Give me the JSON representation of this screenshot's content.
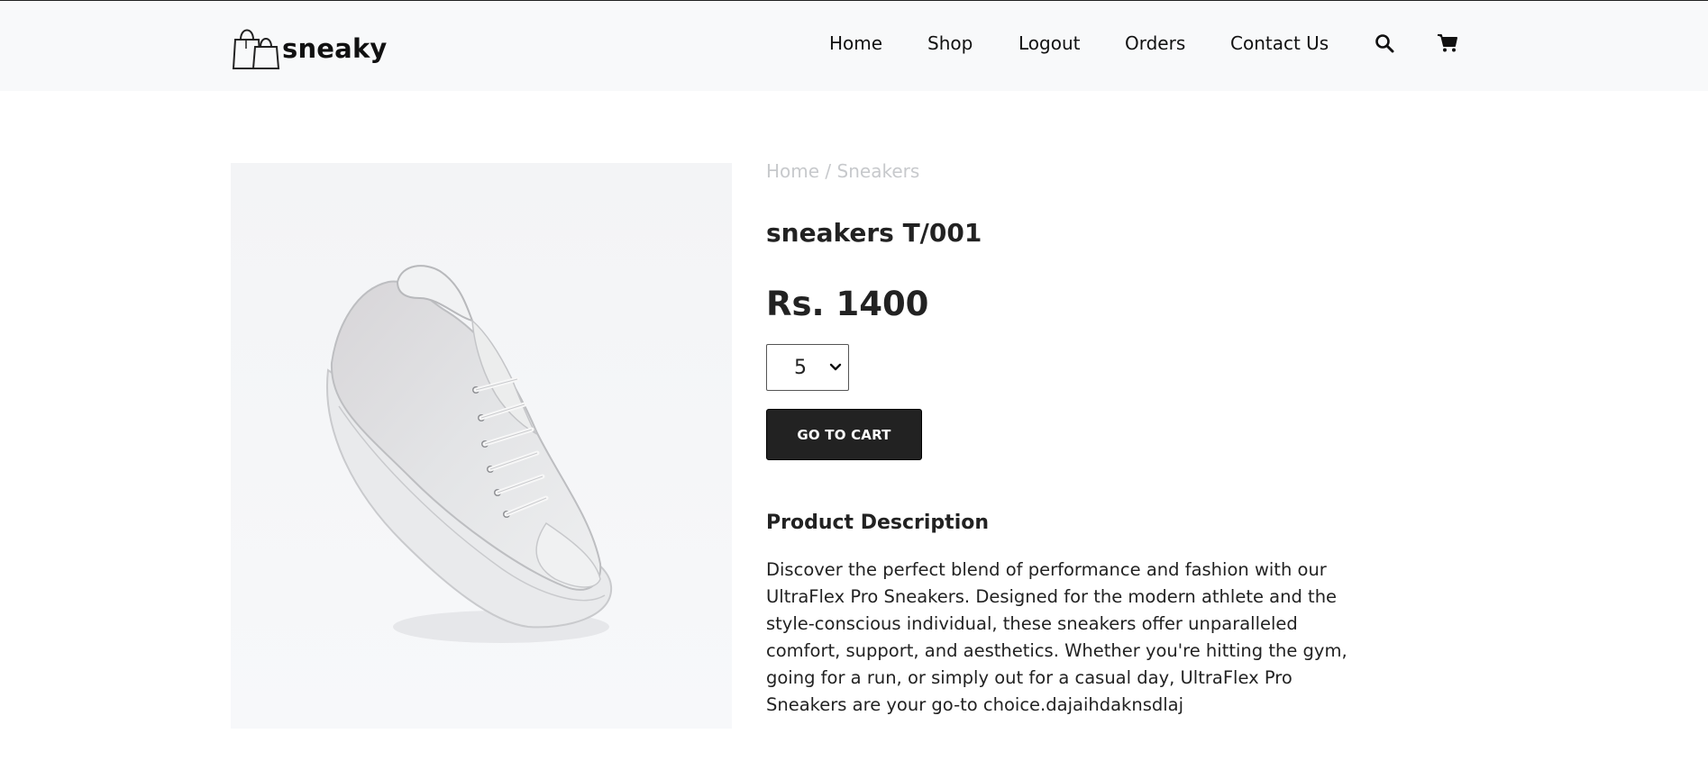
{
  "header": {
    "logo_text": "sneaky",
    "nav": [
      {
        "label": "Home"
      },
      {
        "label": "Shop"
      },
      {
        "label": "Logout"
      },
      {
        "label": "Orders"
      },
      {
        "label": "Contact Us"
      }
    ],
    "icons": [
      "search-icon",
      "cart-icon"
    ]
  },
  "breadcrumb": {
    "home": "Home",
    "separator": " / ",
    "category": "Sneakers"
  },
  "product": {
    "title": "sneakers T/001",
    "price": "Rs. 1400",
    "quantity_selected": "5",
    "go_to_cart_label": "GO TO CART",
    "description_title": "Product Description",
    "description": "Discover the perfect blend of performance and fashion with our UltraFlex Pro Sneakers. Designed for the modern athlete and the style-conscious individual, these sneakers offer unparalleled comfort, support, and aesthetics. Whether you're hitting the gym, going for a run, or simply out for a casual day, UltraFlex Pro Sneakers are your go-to choice.dajaihdaknsdlaj"
  },
  "colors": {
    "header_bg": "#f8f9fa",
    "button_bg": "#222222",
    "breadcrumb_text": "#c7c9cc"
  }
}
